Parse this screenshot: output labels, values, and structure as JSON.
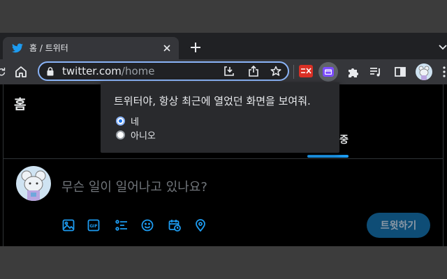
{
  "tab": {
    "title": "홈 / 트위터"
  },
  "address": {
    "host": "twitter.com",
    "path": "/home"
  },
  "page": {
    "header_title": "홈",
    "tab_partial": "중",
    "compose_placeholder": "무슨 일이 일어나고 있나요?",
    "tweet_button": "트윗하기"
  },
  "popup": {
    "question": "트위터야, 항상 최근에 열었던 화면을 보여줘.",
    "options": [
      {
        "label": "네",
        "selected": true
      },
      {
        "label": "아니오",
        "selected": false
      }
    ]
  },
  "colors": {
    "accent": "#1d9bf0",
    "focus": "#8ab4f8"
  },
  "icons": [
    "twitter-bird-icon",
    "close-icon",
    "new-tab-icon",
    "chevron-down-icon",
    "reload-icon",
    "home-icon",
    "lock-icon",
    "install-icon",
    "share-icon",
    "star-icon",
    "extension-red-icon",
    "extension-active-icon",
    "puzzle-icon",
    "media-icon",
    "sidepanel-icon",
    "profile-avatar-icon",
    "menu-icon",
    "image-icon",
    "gif-icon",
    "poll-icon",
    "emoji-icon",
    "schedule-icon",
    "location-icon"
  ]
}
